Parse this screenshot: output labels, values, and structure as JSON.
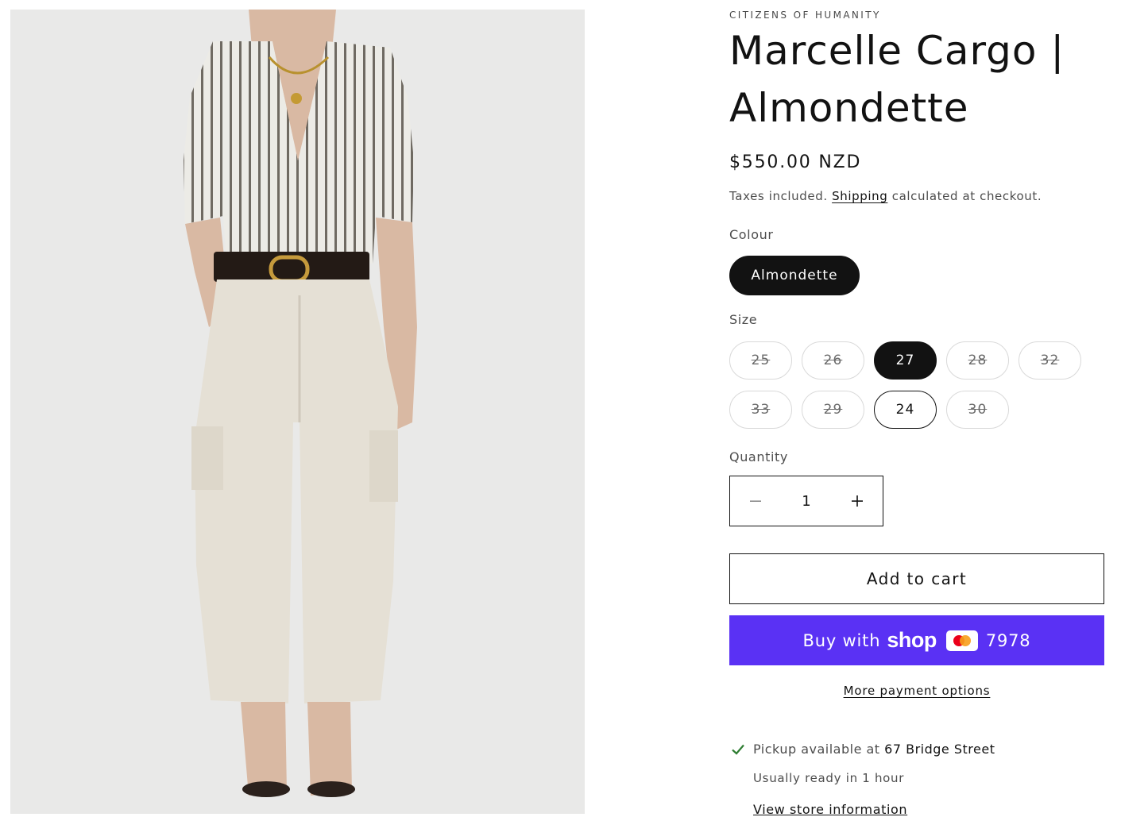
{
  "product_image": {
    "alt": "Model wearing striped shirt, black belt and cream cargo pants"
  },
  "product": {
    "vendor": "CITIZENS OF HUMANITY",
    "title": "Marcelle Cargo | Almondette",
    "price": "$550.00 NZD",
    "tax_prefix": "Taxes included.",
    "shipping_link": "Shipping",
    "tax_suffix": "calculated at checkout."
  },
  "colour": {
    "label": "Colour",
    "options": [
      {
        "label": "Almondette",
        "state": "selected"
      }
    ]
  },
  "size": {
    "label": "Size",
    "options": [
      {
        "label": "25",
        "state": "disabled"
      },
      {
        "label": "26",
        "state": "disabled"
      },
      {
        "label": "27",
        "state": "selected"
      },
      {
        "label": "28",
        "state": "disabled"
      },
      {
        "label": "32",
        "state": "disabled"
      },
      {
        "label": "33",
        "state": "disabled"
      },
      {
        "label": "29",
        "state": "disabled"
      },
      {
        "label": "24",
        "state": "available"
      },
      {
        "label": "30",
        "state": "disabled"
      }
    ]
  },
  "quantity": {
    "label": "Quantity",
    "value": "1",
    "decrease_icon": "minus-icon",
    "increase_icon": "plus-icon"
  },
  "actions": {
    "add_to_cart": "Add to cart",
    "shop_pay_prefix": "Buy with",
    "shop_pay_brand": "shop",
    "shop_pay_card_last4": "7978",
    "more_payment_options": "More payment options"
  },
  "pickup": {
    "prefix": "Pickup available at",
    "location": "67 Bridge Street",
    "ready_text": "Usually ready in 1 hour",
    "store_link": "View store information"
  },
  "colors": {
    "shop_pay": "#5a31f4",
    "selected": "#121212",
    "check": "#2e7d32"
  }
}
